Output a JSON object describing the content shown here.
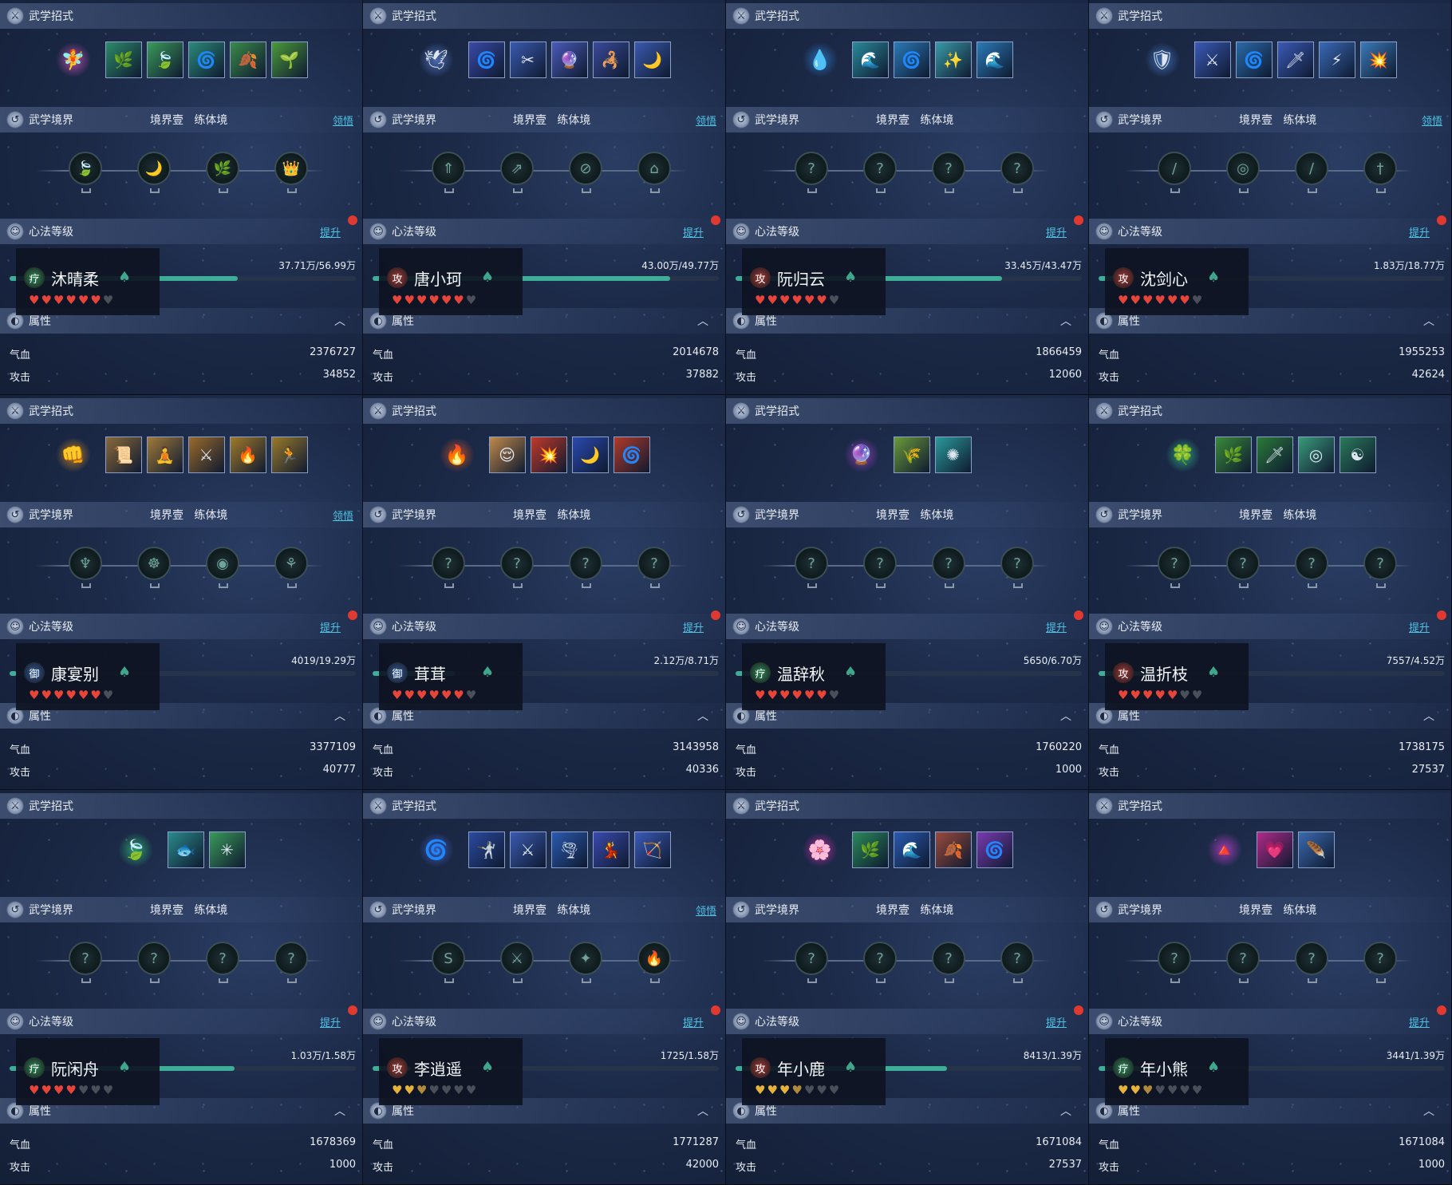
{
  "labels": {
    "skills_header": "武学招式",
    "realm_header": "武学境界",
    "realm_level": "境界壹",
    "realm_stage": "练体境",
    "realm_action": "领悟",
    "xinfa_header": "心法等级",
    "xinfa_action": "提升",
    "attr_header": "属性",
    "hp_label": "气血",
    "atk_label": "攻击"
  },
  "characters": [
    {
      "name": "沐晴柔",
      "role": "疗",
      "role_color": "#2f8a5a",
      "show_realm_link": true,
      "exp_text": "37.71万/56.99万",
      "exp_fraction": 0.66,
      "hearts": [
        "red",
        "red",
        "red",
        "red",
        "red",
        "red",
        "grey"
      ],
      "hp": "2376727",
      "atk": "34852",
      "icons": [
        "🧚",
        "🌿",
        "🍃",
        "🌀",
        "🍂",
        "🌱"
      ],
      "icon_colors": [
        "#b04aa8",
        "#2d8a6a",
        "#3a9a5a",
        "#2b8a7a",
        "#3a8a4a",
        "#4a9a3a"
      ],
      "node_icons": [
        "🍃",
        "🌙",
        "🌿",
        "👑"
      ]
    },
    {
      "name": "唐小珂",
      "role": "攻",
      "role_color": "#a23a3a",
      "show_realm_link": true,
      "exp_text": "43.00万/49.77万",
      "exp_fraction": 0.86,
      "hearts": [
        "red",
        "red",
        "red",
        "red",
        "red",
        "red",
        "grey"
      ],
      "hp": "2014678",
      "atk": "37882",
      "icons": [
        "🕊",
        "🌀",
        "✂",
        "🔮",
        "🦂",
        "🌙"
      ],
      "icon_colors": [
        "#4a6ab0",
        "#3a4aa8",
        "#3a5ab0",
        "#4a5ab8",
        "#3a4a9a",
        "#3a5ab0"
      ],
      "node_icons": [
        "⇑",
        "⇗",
        "⊘",
        "⌂"
      ]
    },
    {
      "name": "阮归云",
      "role": "攻",
      "role_color": "#a23a3a",
      "show_realm_link": false,
      "exp_text": "33.45万/43.47万",
      "exp_fraction": 0.77,
      "hearts": [
        "red",
        "red",
        "red",
        "red",
        "red",
        "red",
        "grey"
      ],
      "hp": "1866459",
      "atk": "12060",
      "icons": [
        "💧",
        "🌊",
        "🌀",
        "✨",
        "🌊"
      ],
      "icon_colors": [
        "#2a6ab0",
        "#2a8a9a",
        "#2a7ab8",
        "#3a9aa8",
        "#2a7ab8"
      ],
      "node_icons": [
        "?",
        "?",
        "?",
        "?"
      ]
    },
    {
      "name": "沈剑心",
      "role": "攻",
      "role_color": "#a23a3a",
      "show_realm_link": true,
      "exp_text": "1.83万/18.77万",
      "exp_fraction": 0.1,
      "hearts": [
        "red",
        "red",
        "red",
        "red",
        "red",
        "red",
        "grey"
      ],
      "hp": "1955253",
      "atk": "42624",
      "icons": [
        "🛡",
        "⚔",
        "🌀",
        "🗡",
        "⚡",
        "💥"
      ],
      "icon_colors": [
        "#3a6ab0",
        "#3a5ab8",
        "#2a6aa8",
        "#3a5ab8",
        "#3a6ab8",
        "#3a7ab8"
      ],
      "node_icons": [
        "/",
        "◎",
        "∕",
        "†"
      ]
    },
    {
      "name": "康宴别",
      "role": "御",
      "role_color": "#2f5aa2",
      "show_realm_link": true,
      "exp_text": "4019/19.29万",
      "exp_fraction": 0.02,
      "hearts": [
        "red",
        "red",
        "red",
        "red",
        "red",
        "red",
        "grey"
      ],
      "hp": "3377109",
      "atk": "40777",
      "icons": [
        "👊",
        "📜",
        "🧘",
        "⚔",
        "🔥",
        "🏃"
      ],
      "icon_colors": [
        "#b07a2a",
        "#8a6a3a",
        "#a07a3a",
        "#9a6a2a",
        "#a07a2a",
        "#9a7a2a"
      ],
      "node_icons": [
        "♆",
        "☸",
        "◉",
        "⚘"
      ]
    },
    {
      "name": "茸茸",
      "role": "御",
      "role_color": "#2f5aa2",
      "show_realm_link": false,
      "exp_text": "2.12万/8.71万",
      "exp_fraction": 0.24,
      "hearts": [
        "red",
        "red",
        "red",
        "red",
        "red",
        "red",
        "grey"
      ],
      "hp": "3143958",
      "atk": "40336",
      "icons": [
        "🔥",
        "😌",
        "💥",
        "🌙",
        "🌀"
      ],
      "icon_colors": [
        "#b04a2a",
        "#c08a4a",
        "#c03a2a",
        "#2a4ab0",
        "#b03a2a"
      ],
      "node_icons": [
        "?",
        "?",
        "?",
        "?"
      ]
    },
    {
      "name": "温辞秋",
      "role": "疗",
      "role_color": "#2f8a5a",
      "show_realm_link": false,
      "exp_text": "5650/6.70万",
      "exp_fraction": 0.08,
      "hearts": [
        "red",
        "red",
        "red",
        "red",
        "red",
        "red",
        "grey"
      ],
      "hp": "1760220",
      "atk": "1000",
      "icons": [
        "🔮",
        "🌾",
        "✺"
      ],
      "icon_colors": [
        "#8a3ab0",
        "#6a9a3a",
        "#2a9a9a"
      ],
      "node_icons": [
        "?",
        "?",
        "?",
        "?"
      ]
    },
    {
      "name": "温折枝",
      "role": "攻",
      "role_color": "#a23a3a",
      "show_realm_link": false,
      "exp_text": "7557/4.52万",
      "exp_fraction": 0.17,
      "hearts": [
        "red",
        "red",
        "red",
        "red",
        "red",
        "grey",
        "grey"
      ],
      "hp": "1738175",
      "atk": "27537",
      "icons": [
        "🍀",
        "🌿",
        "🗡",
        "◎",
        "☯"
      ],
      "icon_colors": [
        "#2a9a7a",
        "#3a8a3a",
        "#2a7a3a",
        "#3a9a7a",
        "#2a7a5a"
      ],
      "node_icons": [
        "?",
        "?",
        "?",
        "?"
      ]
    },
    {
      "name": "阮闲舟",
      "role": "疗",
      "role_color": "#2f8a5a",
      "show_realm_link": false,
      "exp_text": "1.03万/1.58万",
      "exp_fraction": 0.65,
      "hearts": [
        "red",
        "red",
        "red",
        "red",
        "grey",
        "grey",
        "grey"
      ],
      "hp": "1678369",
      "atk": "1000",
      "icons": [
        "🍃",
        "🐟",
        "✳"
      ],
      "icon_colors": [
        "#2a9a6a",
        "#2a8a8a",
        "#3a9a5a"
      ],
      "node_icons": [
        "?",
        "?",
        "?",
        "?"
      ]
    },
    {
      "name": "李逍遥",
      "role": "攻",
      "role_color": "#a23a3a",
      "show_realm_link": true,
      "exp_text": "1725/1.58万",
      "exp_fraction": 0.11,
      "hearts": [
        "gold",
        "gold",
        "half",
        "grey",
        "grey",
        "grey",
        "grey"
      ],
      "hp": "1771287",
      "atk": "42000",
      "icons": [
        "🌀",
        "🤺",
        "⚔",
        "🌪",
        "💃",
        "🏹"
      ],
      "icon_colors": [
        "#3a5ab8",
        "#2a4aa0",
        "#3a5ab0",
        "#2a5ab0",
        "#3a4ab0",
        "#3a5ab8"
      ],
      "node_icons": [
        "S",
        "⚔",
        "✦",
        "🔥"
      ]
    },
    {
      "name": "年小鹿",
      "role": "攻",
      "role_color": "#a23a3a",
      "show_realm_link": false,
      "exp_text": "8413/1.39万",
      "exp_fraction": 0.61,
      "hearts": [
        "gold",
        "gold",
        "gold",
        "half",
        "grey",
        "grey",
        "grey"
      ],
      "hp": "1671084",
      "atk": "27537",
      "icons": [
        "🌸",
        "🌿",
        "🌊",
        "🍂",
        "🌀"
      ],
      "icon_colors": [
        "#b02a9a",
        "#2a8a5a",
        "#2a5ab0",
        "#9a4a3a",
        "#7a3ab0"
      ],
      "node_icons": [
        "?",
        "?",
        "?",
        "?"
      ]
    },
    {
      "name": "年小熊",
      "role": "疗",
      "role_color": "#2f8a5a",
      "show_realm_link": false,
      "exp_text": "3441/1.39万",
      "exp_fraction": 0.25,
      "hearts": [
        "gold",
        "gold",
        "half",
        "grey",
        "grey",
        "grey",
        "grey"
      ],
      "hp": "1671084",
      "atk": "1000",
      "icons": [
        "🔺",
        "💗",
        "🪶"
      ],
      "icon_colors": [
        "#9a3ab0",
        "#b02a8a",
        "#3a6ab0"
      ],
      "node_icons": [
        "?",
        "?",
        "?",
        "?"
      ]
    }
  ]
}
